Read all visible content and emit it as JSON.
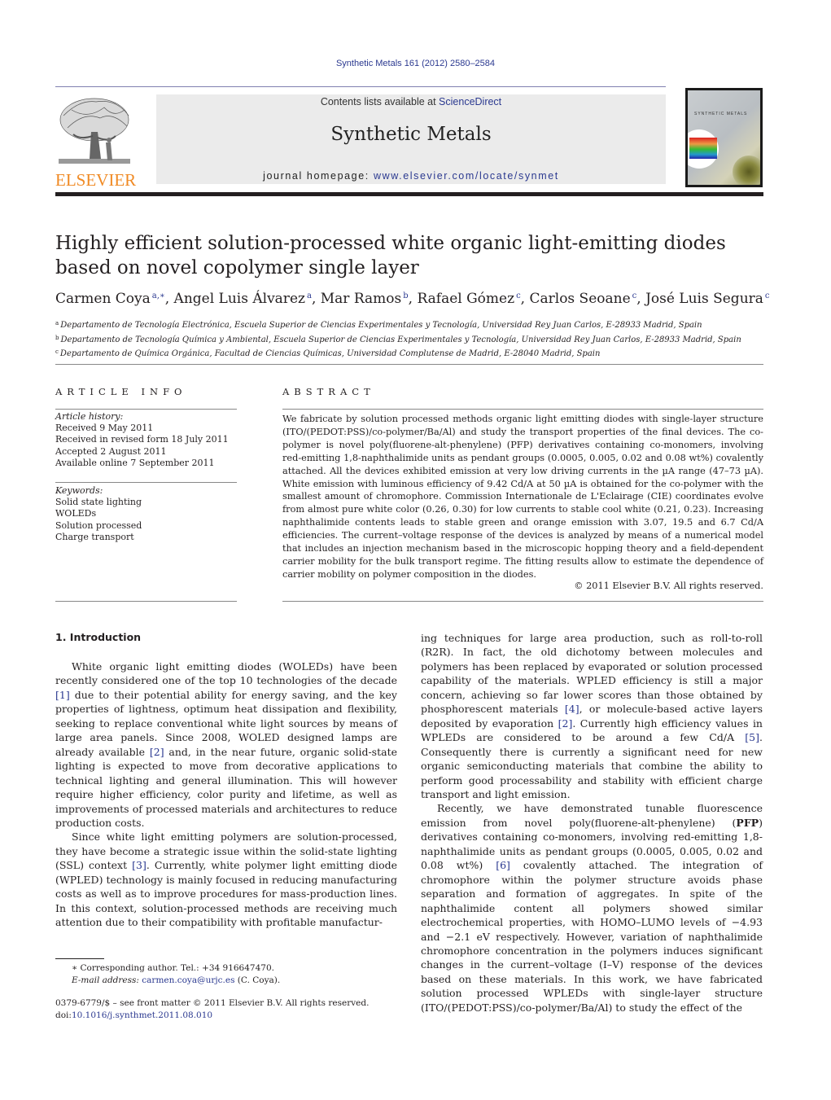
{
  "header": {
    "citation": "Synthetic Metals 161 (2012) 2580–2584",
    "publisher_logo_text": "ELSEVIER",
    "contents_prefix": "Contents lists available at ",
    "contents_link": "ScienceDirect",
    "journal_title": "Synthetic Metals",
    "homepage_prefix": "journal homepage: ",
    "homepage_link": "www.elsevier.com/locate/synmet",
    "cover_title": "SYNTHETIC METALS"
  },
  "article": {
    "title": "Highly efficient solution-processed white organic light-emitting diodes based on novel copolymer single layer",
    "authors": [
      {
        "name": "Carmen Coya",
        "aff": "a,∗"
      },
      {
        "name": "Angel Luis Álvarez",
        "aff": "a"
      },
      {
        "name": "Mar Ramos",
        "aff": "b"
      },
      {
        "name": "Rafael Gómez",
        "aff": "c"
      },
      {
        "name": "Carlos Seoane",
        "aff": "c"
      },
      {
        "name": "José Luis Segura",
        "aff": "c"
      }
    ],
    "affiliations": [
      {
        "key": "a",
        "text": "Departamento de Tecnología Electrónica, Escuela Superior de Ciencias Experimentales y Tecnología, Universidad Rey Juan Carlos, E-28933 Madrid, Spain"
      },
      {
        "key": "b",
        "text": "Departamento de Tecnología Química y Ambiental, Escuela Superior de Ciencias Experimentales y Tecnología, Universidad Rey Juan Carlos, E-28933 Madrid, Spain"
      },
      {
        "key": "c",
        "text": "Departamento de Química Orgánica, Facultad de Ciencias Químicas, Universidad Complutense de Madrid, E-28040 Madrid, Spain"
      }
    ]
  },
  "article_info": {
    "heading": "ARTICLE INFO",
    "history_label": "Article history:",
    "history": [
      "Received 9 May 2011",
      "Received in revised form 18 July 2011",
      "Accepted 2 August 2011",
      "Available online 7 September 2011"
    ],
    "keywords_label": "Keywords:",
    "keywords": [
      "Solid state lighting",
      "WOLEDs",
      "Solution processed",
      "Charge transport"
    ]
  },
  "abstract": {
    "heading": "ABSTRACT",
    "text": "We fabricate by solution processed methods organic light emitting diodes with single-layer structure (ITO/(PEDOT:PSS)/co-polymer/Ba/Al) and study the transport properties of the final devices. The co-polymer is novel poly(fluorene-alt-phenylene) (PFP) derivatives containing co-monomers, involving red-emitting 1,8-naphthalimide units as pendant groups (0.0005, 0.005, 0.02 and 0.08 wt%) covalently attached. All the devices exhibited emission at very low driving currents in the µA range (47–73 µA). White emission with luminous efficiency of 9.42 Cd/A at 50 µA is obtained for the co-polymer with the smallest amount of chromophore. Commission Internationale de L'Eclairage (CIE) coordinates evolve from almost pure white color (0.26, 0.30) for low currents to stable cool white (0.21, 0.23). Increasing naphthalimide contents leads to stable green and orange emission with 3.07, 19.5 and 6.7 Cd/A efficiencies. The current–voltage response of the devices is analyzed by means of a numerical model that includes an injection mechanism based in the microscopic hopping theory and a field-dependent carrier mobility for the bulk transport regime. The fitting results allow to estimate the dependence of carrier mobility on polymer composition in the diodes.",
    "copyright": "© 2011 Elsevier B.V. All rights reserved."
  },
  "body": {
    "section_heading": "1.  Introduction",
    "left_paragraphs": [
      [
        {
          "t": "White organic light emitting diodes (WOLEDs) have been recently considered one of the top 10 technologies of the decade "
        },
        {
          "ref": "[1]"
        },
        {
          "t": " due to their potential ability for energy saving, and the key properties of lightness, optimum heat dissipation and flexibility, seeking to replace conventional white light sources by means of large area panels. Since 2008, WOLED designed lamps are already available "
        },
        {
          "ref": "[2]"
        },
        {
          "t": " and, in the near future, organic solid-state lighting is expected to move from decorative applications to technical lighting and general illumination. This will however require higher efficiency, color purity and lifetime, as well as improvements of processed materials and architectures to reduce production costs."
        }
      ],
      [
        {
          "t": "Since white light emitting polymers are solution-processed, they have become a strategic issue within the solid-state lighting (SSL) context "
        },
        {
          "ref": "[3]"
        },
        {
          "t": ". Currently, white polymer light emitting diode (WPLED) technology is mainly focused in reducing manufacturing costs as well as to improve procedures for mass-production lines. In this context, solution-processed methods are receiving much attention due to their compatibility with profitable manufactur-"
        }
      ]
    ],
    "right_paragraphs": [
      [
        {
          "t": "ing techniques for large area production, such as roll-to-roll (R2R). In fact, the old dichotomy between molecules and polymers has been replaced by evaporated or solution processed capability of the materials. WPLED efficiency is still a major concern, achieving so far lower scores than those obtained by phosphorescent materials "
        },
        {
          "ref": "[4]"
        },
        {
          "t": ", or molecule-based active layers deposited by evaporation "
        },
        {
          "ref": "[2]"
        },
        {
          "t": ". Currently high efficiency values in WPLEDs are considered to be around a few Cd/A "
        },
        {
          "ref": "[5]"
        },
        {
          "t": ". Consequently there is currently a significant need for new organic semiconducting materials that combine the ability to perform good processability and stability with efficient charge transport and light emission."
        }
      ],
      [
        {
          "t": "Recently, we have demonstrated tunable fluorescence emission from novel poly(fluorene-alt-phenylene) ("
        },
        {
          "b": "PFP"
        },
        {
          "t": ") derivatives containing co-monomers, involving red-emitting 1,8-naphthalimide units as pendant groups (0.0005, 0.005, 0.02 and 0.08 wt%) "
        },
        {
          "ref": "[6]"
        },
        {
          "t": " covalently attached. The integration of chromophore within the polymer structure avoids phase separation and formation of aggregates. In spite of the naphthalimide content all polymers showed similar electrochemical properties, with HOMO–LUMO levels of −4.93 and −2.1 eV respectively. However, variation of naphthalimide chromophore concentration in the polymers induces significant changes in the current–voltage (I–V) response of the devices based on these materials. In this work, we have fabricated solution processed WPLEDs with single-layer structure (ITO/(PEDOT:PSS)/co-polymer/Ba/Al) to study the effect of the"
        }
      ]
    ]
  },
  "footnotes": {
    "corresponding": "∗  Corresponding author. Tel.: +34 916647470.",
    "email_label": "E-mail address: ",
    "email": "carmen.coya@urjc.es",
    "email_suffix": " (C. Coya).",
    "issn_line": "0379-6779/$ – see front matter © 2011  Elsevier B.V. All rights reserved.",
    "doi_prefix": "doi:",
    "doi": "10.1016/j.synthmet.2011.08.010"
  },
  "colors": {
    "link": "#2b3990",
    "elsevier_orange": "#f08a24",
    "banner_bg": "#ebebeb",
    "rule": "#231f20"
  }
}
